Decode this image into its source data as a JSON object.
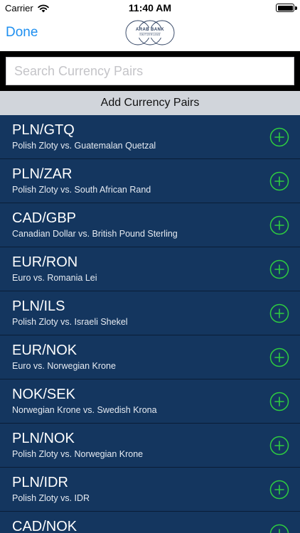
{
  "status_bar": {
    "carrier": "Carrier",
    "time": "11:40 AM",
    "wifi_icon": "wifi-icon",
    "battery_icon": "battery-icon"
  },
  "nav_bar": {
    "done_label": "Done",
    "logo": {
      "name": "ARAB BANK",
      "sub": "SWITZERLAND"
    }
  },
  "search": {
    "placeholder": "Search Currency Pairs",
    "value": ""
  },
  "section": {
    "title": "Add Currency Pairs"
  },
  "pairs": [
    {
      "code": "PLN/GTQ",
      "desc": "Polish Zloty vs. Guatemalan Quetzal"
    },
    {
      "code": "PLN/ZAR",
      "desc": "Polish Zloty vs. South African Rand"
    },
    {
      "code": "CAD/GBP",
      "desc": "Canadian Dollar vs. British Pound Sterling"
    },
    {
      "code": "EUR/RON",
      "desc": "Euro vs. Romania Lei"
    },
    {
      "code": "PLN/ILS",
      "desc": "Polish Zloty vs. Israeli Shekel"
    },
    {
      "code": "EUR/NOK",
      "desc": "Euro vs. Norwegian Krone"
    },
    {
      "code": "NOK/SEK",
      "desc": "Norwegian Krone vs. Swedish Krona"
    },
    {
      "code": "PLN/NOK",
      "desc": "Polish Zloty vs. Norwegian Krone"
    },
    {
      "code": "PLN/IDR",
      "desc": "Polish Zloty vs. IDR"
    },
    {
      "code": "CAD/NOK",
      "desc": ""
    }
  ],
  "colors": {
    "accent": "#1e8ff0",
    "list_background": "#14365f",
    "add_icon": "#2ecc40",
    "section_header": "#d1d5db",
    "search_bar": "#000000"
  },
  "icons": {
    "add": "plus-circle-icon"
  }
}
